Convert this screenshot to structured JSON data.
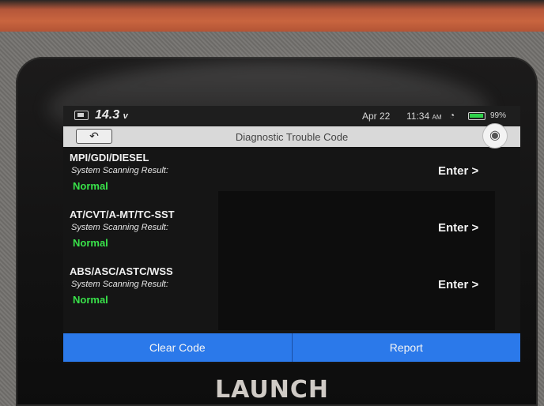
{
  "status_bar": {
    "voltage": "14.3",
    "voltage_unit": "v",
    "date": "Apr 22",
    "time": "11:34",
    "time_suffix": "AM",
    "battery": "99%"
  },
  "title_bar": {
    "back_icon": "back-arrow-icon",
    "title": "Diagnostic Trouble Code",
    "camera_icon": "camera-icon"
  },
  "systems": [
    {
      "name": "MPI/GDI/DIESEL",
      "label": "System Scanning Result:",
      "result": "Normal",
      "action": "Enter >"
    },
    {
      "name": "AT/CVT/A-MT/TC-SST",
      "label": "System Scanning Result:",
      "result": "Normal",
      "action": "Enter >"
    },
    {
      "name": "ABS/ASC/ASTC/WSS",
      "label": "System Scanning Result:",
      "result": "Normal",
      "action": "Enter >"
    }
  ],
  "footer": {
    "clear_code": "Clear Code",
    "report": "Report"
  },
  "device": {
    "brand": "LAUNCH"
  },
  "colors": {
    "result_ok": "#39e24a",
    "button_blue": "#2b79ea",
    "case_orange": "#c9653f"
  }
}
